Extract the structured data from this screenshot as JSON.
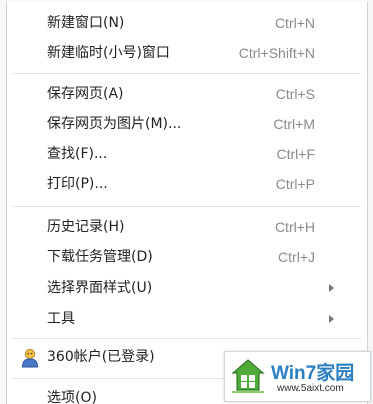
{
  "menu": {
    "items": [
      {
        "label": "新建窗口(N)",
        "shortcut": "Ctrl+N"
      },
      {
        "label": "新建临时(小号)窗口",
        "shortcut": "Ctrl+Shift+N"
      },
      {
        "label": "保存网页(A)",
        "shortcut": "Ctrl+S"
      },
      {
        "label": "保存网页为图片(M)...",
        "shortcut": "Ctrl+M"
      },
      {
        "label": "查找(F)...",
        "shortcut": "Ctrl+F"
      },
      {
        "label": "打印(P)...",
        "shortcut": "Ctrl+P"
      },
      {
        "label": "历史记录(H)",
        "shortcut": "Ctrl+H"
      },
      {
        "label": "下载任务管理(D)",
        "shortcut": "Ctrl+J"
      },
      {
        "label": "选择界面样式(U)",
        "shortcut": ""
      },
      {
        "label": "工具",
        "shortcut": ""
      },
      {
        "label": "360帐户(已登录)",
        "shortcut": ""
      },
      {
        "label": "选项(O)",
        "shortcut": ""
      }
    ]
  },
  "watermark": {
    "title": "Win7家园",
    "url": "www.5aixt.com"
  },
  "colors": {
    "watermark_text": "#2b7fc3",
    "submenu_arrow": "#777777"
  }
}
